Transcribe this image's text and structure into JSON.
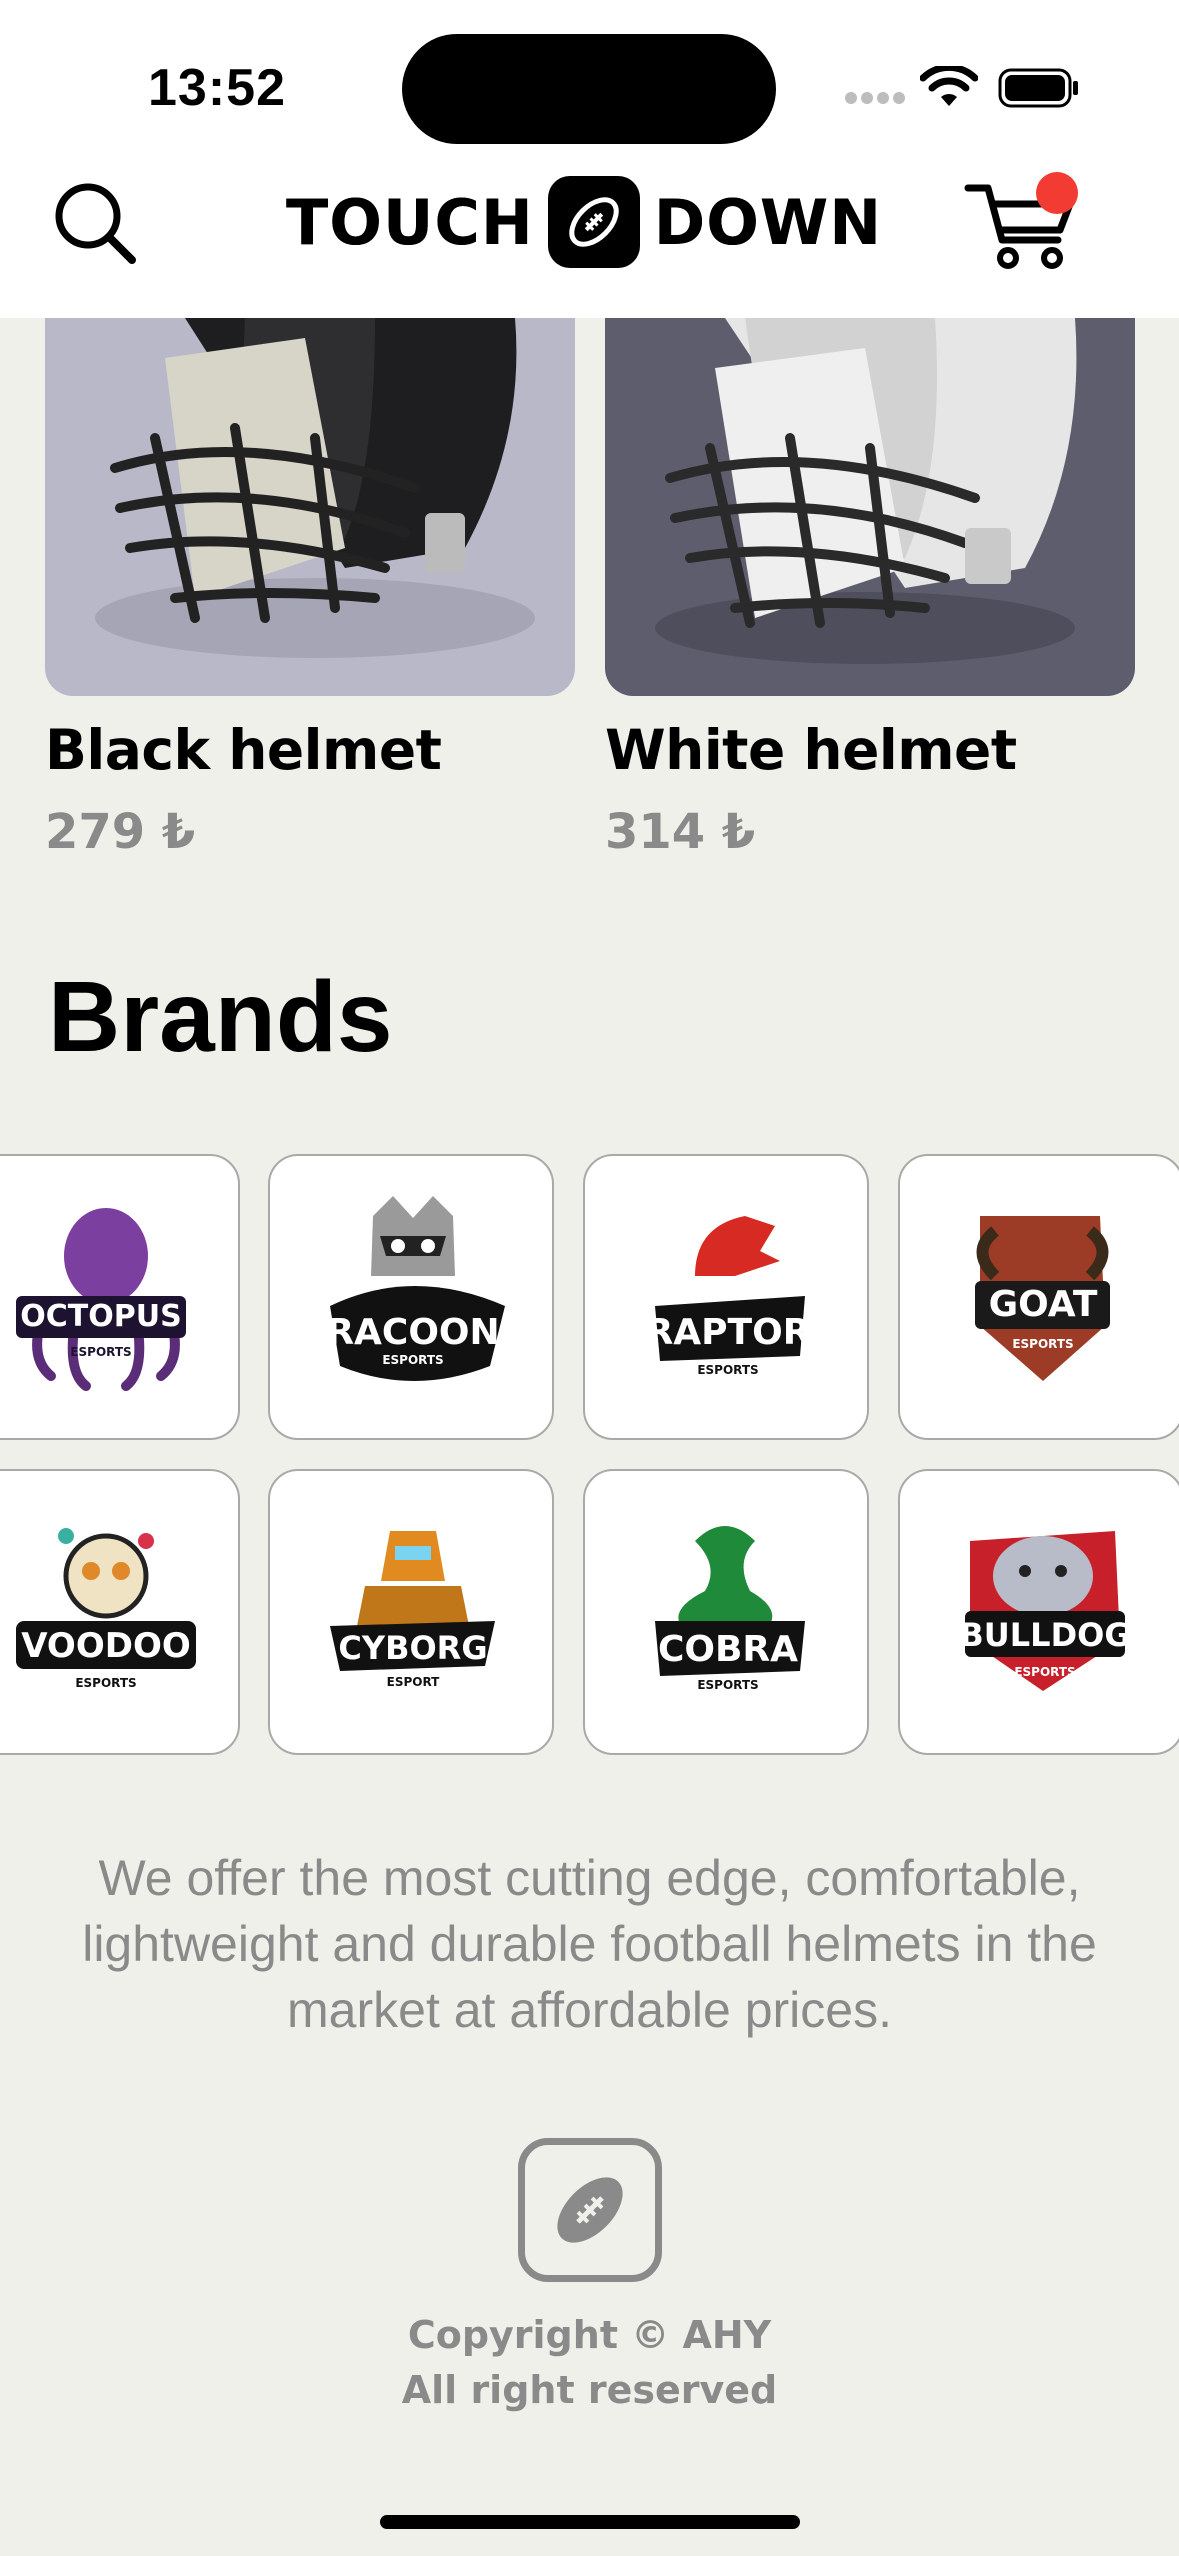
{
  "status_bar": {
    "time": "13:52"
  },
  "header": {
    "logo_left": "TOUCH",
    "logo_right": "DOWN",
    "search_icon": "search-icon",
    "cart_icon": "cart-icon",
    "cart_badge_color": "#f23b32"
  },
  "products": [
    {
      "name": "Black helmet",
      "price": "279 ₺",
      "image_bg": "#b9b8c8",
      "helmet": "black"
    },
    {
      "name": "White helmet",
      "price": "314 ₺",
      "image_bg": "#5e5d6d",
      "helmet": "white"
    }
  ],
  "brands": {
    "title": "Brands",
    "items": [
      {
        "logo_text": "OCTOPUS",
        "sub": "ESPORTS",
        "color": "#7b3fa0"
      },
      {
        "logo_text": "RACOON",
        "sub": "ESPORTS",
        "color": "#222222"
      },
      {
        "logo_text": "RAPTOR",
        "sub": "ESPORTS",
        "color": "#d62a22"
      },
      {
        "logo_text": "GOAT",
        "sub": "ESPORTS",
        "color": "#9c3b26"
      },
      {
        "logo_text": "VOODOO",
        "sub": "ESPORTS",
        "color": "#e3c27a"
      },
      {
        "logo_text": "CYBORG",
        "sub": "ESPORT",
        "color": "#e08a1f"
      },
      {
        "logo_text": "COBRA",
        "sub": "ESPORTS",
        "color": "#1f8a3a"
      },
      {
        "logo_text": "BULLDOG",
        "sub": "ESPORTS",
        "color": "#c8202a"
      }
    ]
  },
  "footer": {
    "description": "We offer the most cutting edge, comfortable, lightweight and durable football helmets in the market at affordable prices.",
    "copyright_line1": "Copyright © AHY",
    "copyright_line2": "All right reserved"
  }
}
